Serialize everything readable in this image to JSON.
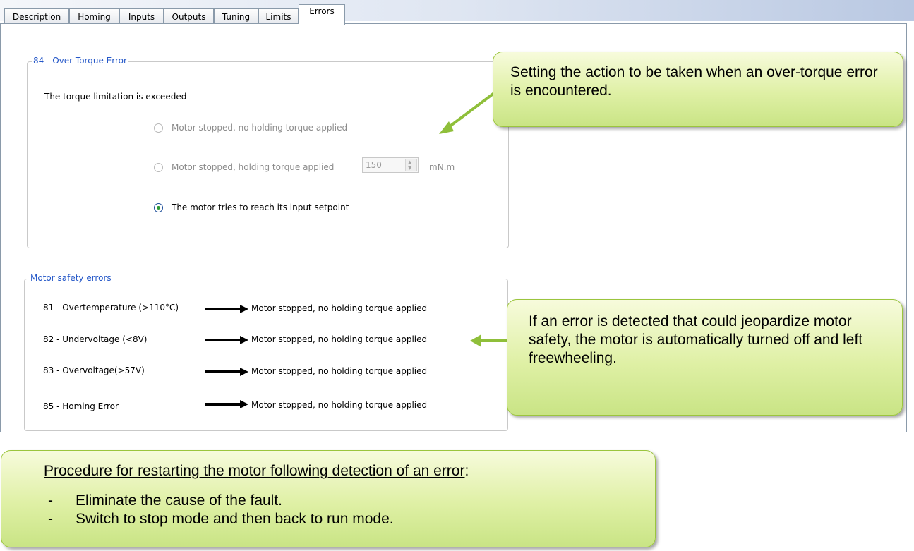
{
  "tabs": [
    {
      "label": "Description"
    },
    {
      "label": "Homing"
    },
    {
      "label": "Inputs"
    },
    {
      "label": "Outputs"
    },
    {
      "label": "Tuning"
    },
    {
      "label": "Limits"
    },
    {
      "label": "Errors",
      "active": true
    }
  ],
  "over_torque": {
    "title": "84 - Over Torque Error",
    "description": "The torque limitation is exceeded",
    "options": [
      {
        "label": "Motor stopped, no holding torque applied",
        "selected": false,
        "enabled": false
      },
      {
        "label": "Motor stopped, holding torque applied",
        "selected": false,
        "enabled": false
      },
      {
        "label": "The motor tries to reach its input setpoint",
        "selected": true,
        "enabled": true
      }
    ],
    "holding_torque_value": "150",
    "holding_torque_unit": "mN.m"
  },
  "motor_safety": {
    "title": "Motor safety errors",
    "rows": [
      {
        "error": "81 - Overtemperature (>110°C)",
        "action": "Motor stopped, no holding torque applied"
      },
      {
        "error": "82 - Undervoltage (<8V)",
        "action": "Motor stopped, no holding torque applied"
      },
      {
        "error": "83 - Overvoltage(>57V)",
        "action": "Motor stopped, no holding torque applied"
      },
      {
        "error": "85 - Homing Error",
        "action": "Motor stopped, no holding torque applied"
      }
    ]
  },
  "callouts": {
    "torque_action": "Setting the action to be taken when an over-torque error is encountered.",
    "safety_info": "If an error is detected that could jeopardize motor safety, the motor is automatically turned off and left freewheeling.",
    "restart_title": "Procedure for restarting the motor following detection of an error",
    "restart_title_suffix": ":",
    "restart_steps": [
      "Eliminate the cause of the fault.",
      "Switch to stop mode and then back to run mode."
    ]
  },
  "colors": {
    "legend_blue": "#2457c8",
    "callout_border": "#9bc53d",
    "callout_arrow": "#8fbf3a",
    "radio_dot": "#2c9a34"
  },
  "icons": {
    "row_arrow": "right-arrow-icon",
    "spinner": "spin-updown-icon"
  }
}
